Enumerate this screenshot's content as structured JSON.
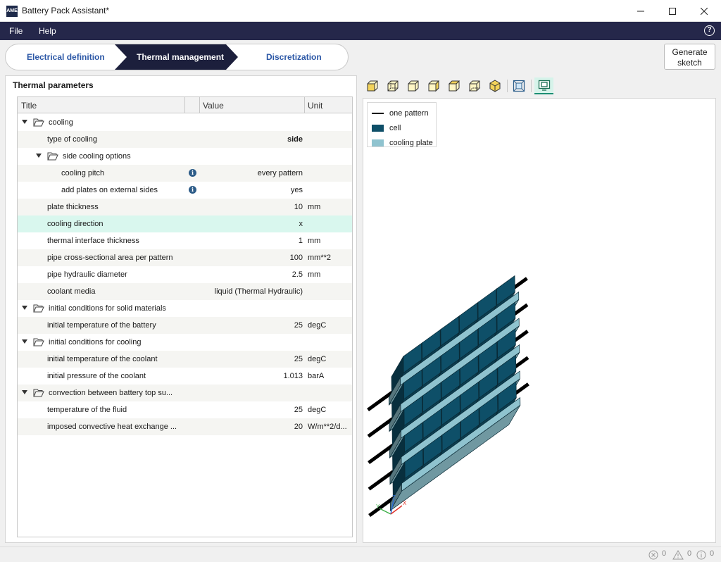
{
  "window": {
    "title": "Battery Pack Assistant*",
    "app_icon_text": "AME"
  },
  "menu": {
    "file": "File",
    "help": "Help",
    "help_icon": "?"
  },
  "steps": [
    {
      "label": "Electrical definition",
      "active": false
    },
    {
      "label": "Thermal management",
      "active": true
    },
    {
      "label": "Discretization",
      "active": false
    }
  ],
  "generate_button": {
    "line1": "Generate",
    "line2": "sketch"
  },
  "left": {
    "panel_title": "Thermal parameters",
    "columns": {
      "title": "Title",
      "value": "Value",
      "unit": "Unit"
    },
    "rows": [
      {
        "title": "cooling",
        "value": "",
        "unit": "",
        "group": true
      },
      {
        "title": "type of cooling",
        "value": "side",
        "unit": ""
      },
      {
        "title": "side cooling options",
        "value": "",
        "unit": "",
        "group": true
      },
      {
        "title": "cooling pitch",
        "value": "every pattern",
        "unit": "",
        "info": "i"
      },
      {
        "title": "add plates on external sides",
        "value": "yes",
        "unit": "",
        "info": "i"
      },
      {
        "title": "plate thickness",
        "value": "10",
        "unit": "mm"
      },
      {
        "title": "cooling direction",
        "value": "x",
        "unit": "",
        "selected": true
      },
      {
        "title": "thermal interface thickness",
        "value": "1",
        "unit": "mm"
      },
      {
        "title": "pipe cross-sectional area per pattern",
        "value": "100",
        "unit": "mm**2"
      },
      {
        "title": "pipe hydraulic diameter",
        "value": "2.5",
        "unit": "mm"
      },
      {
        "title": "coolant media",
        "value": "liquid (Thermal Hydraulic)",
        "unit": ""
      },
      {
        "title": "initial conditions for solid materials",
        "value": "",
        "unit": "",
        "group": true
      },
      {
        "title": "initial temperature of the battery",
        "value": "25",
        "unit": "degC"
      },
      {
        "title": "initial conditions for cooling",
        "value": "",
        "unit": "",
        "group": true
      },
      {
        "title": "initial temperature of the coolant",
        "value": "25",
        "unit": "degC"
      },
      {
        "title": "initial pressure of the coolant",
        "value": "1.013",
        "unit": "barA"
      },
      {
        "title": "convection between battery top su...",
        "value": "",
        "unit": "",
        "group": true
      },
      {
        "title": "temperature of the fluid",
        "value": "25",
        "unit": "degC"
      },
      {
        "title": "imposed convective heat exchange ...",
        "value": "20",
        "unit": "W/m**2/d..."
      }
    ]
  },
  "right": {
    "toolbar_icons": [
      "view-front-icon",
      "view-back-icon",
      "view-left-icon",
      "view-right-icon",
      "view-top-icon",
      "view-bottom-icon",
      "view-iso-icon",
      "fit-view-icon",
      "sketch-view-icon"
    ],
    "legend": [
      {
        "label": "one pattern",
        "kind": "line",
        "color": "#000000"
      },
      {
        "label": "cell",
        "kind": "box",
        "color": "#0e4f68"
      },
      {
        "label": "cooling plate",
        "kind": "box",
        "color": "#8fc3cf"
      }
    ],
    "axes": {
      "x": "X",
      "y": "Y",
      "z": "Z"
    }
  },
  "status": {
    "errors": "0",
    "warnings": "0",
    "infos": "0"
  },
  "colors": {
    "menu_bg": "#25274a",
    "active_step": "#1c1f3c",
    "link_blue": "#2b57a6",
    "selected_row": "#d9f7ee",
    "cell": "#0e4f68",
    "cooling_plate": "#8fc3cf"
  }
}
